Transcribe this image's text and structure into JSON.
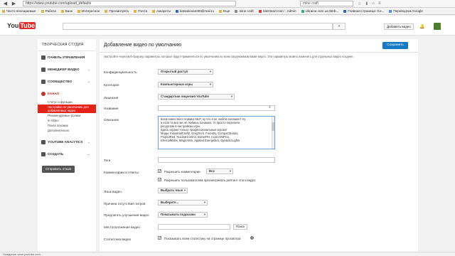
{
  "browser": {
    "url": "https://www.youtube.com/upload_defaults",
    "search": "mine craft",
    "bookmarks": [
      "Часто посещаемые",
      "Работа",
      "Банк",
      "Интересное",
      "Просмотреть",
      "Почта",
      "Аккаунты",
      "katsakovam80@mail.ru",
      "Еще",
      "mine craft",
      "SiteHeart.com :: Admin",
      "Ukraine.com.ua Web...",
      "Главная страница: Go...",
      "Переводчик Google"
    ]
  },
  "header": {
    "logo_you": "You",
    "logo_tube": "Tube",
    "upload_label": "Добавить видео"
  },
  "sidebar": {
    "title": "ТВОРЧЕСКАЯ СТУДИЯ",
    "items": [
      {
        "label": "ПАНЕЛЬ УПРАВЛЕНИЯ"
      },
      {
        "label": "МЕНЕДЖЕР ВИДЕО"
      },
      {
        "label": "СООБЩЕСТВО"
      },
      {
        "label": "КАНАЛ"
      }
    ],
    "channel_subs": [
      "Статус и функции",
      "Настройки по умолчанию для добавляемых видео",
      "Рекомендуемые ролики",
      "In-Video",
      "Поиск похожих",
      "Дополнительно"
    ],
    "items_bottom": [
      {
        "label": "YOUTUBE ANALYTICS"
      },
      {
        "label": "СОЗДАТЬ"
      }
    ],
    "send_feedback": "Отправить отзыв"
  },
  "main": {
    "title": "Добавление видео по умолчанию",
    "save_label": "Сохранить",
    "description": "Настройте через веб-браузер параметры, которые будут применяться по умолчанию ко всем загружаемым вами видео. Эти параметры можно изменить для отдельных видео позднее.",
    "privacy": {
      "label": "Конфиденциальность",
      "value": "Открытый доступ"
    },
    "category": {
      "label": "Категория",
      "value": "Компьютерные игры"
    },
    "license": {
      "label": "Лицензия",
      "value": "Стандартная лицензия YouTube"
    },
    "name_label": "Название",
    "desc_label": "Описание",
    "desc_lines": [
      "всем известного сервака MLP, ну что я не люблю поняшек? Ну",
      "а если та все же не любишь поняшек, то просто перелючи",
      "ресурспак в настройках игры.",
      "Здесь играют только профессиональные игроки!",
      "Моды: IndustrialCraft2, GregTech, Forestry, CompactSolars,",
      "ProjectRed, NuclearControl, BoraxFM, CustomNPCs,",
      "InfernalMobs, MagicYarn, Applied Energistics, DynamicLights"
    ],
    "tags_label": "Теги",
    "comments": {
      "label": "Комментарии и ответы",
      "allow": "Разрешить комментарии",
      "allow_value": "Все",
      "ratings": "Разрешить пользователям просматривать рейтинг этого видео"
    },
    "language": {
      "label": "Язык видео",
      "value": "Выбрать язык"
    },
    "caption": {
      "label": "Причина отсутствия титров",
      "value": "Выберите..."
    },
    "suggest": {
      "label": "Предлагать улучшения видео",
      "value": "Показывать подсказки"
    },
    "location": {
      "label": "Местоположение видео",
      "search": "Поиск"
    },
    "stats": {
      "label": "Статистика видео",
      "value": "Показывать всем статистику на странице просмотра"
    }
  },
  "status_bar": "Ожидание www.youtube.com..."
}
